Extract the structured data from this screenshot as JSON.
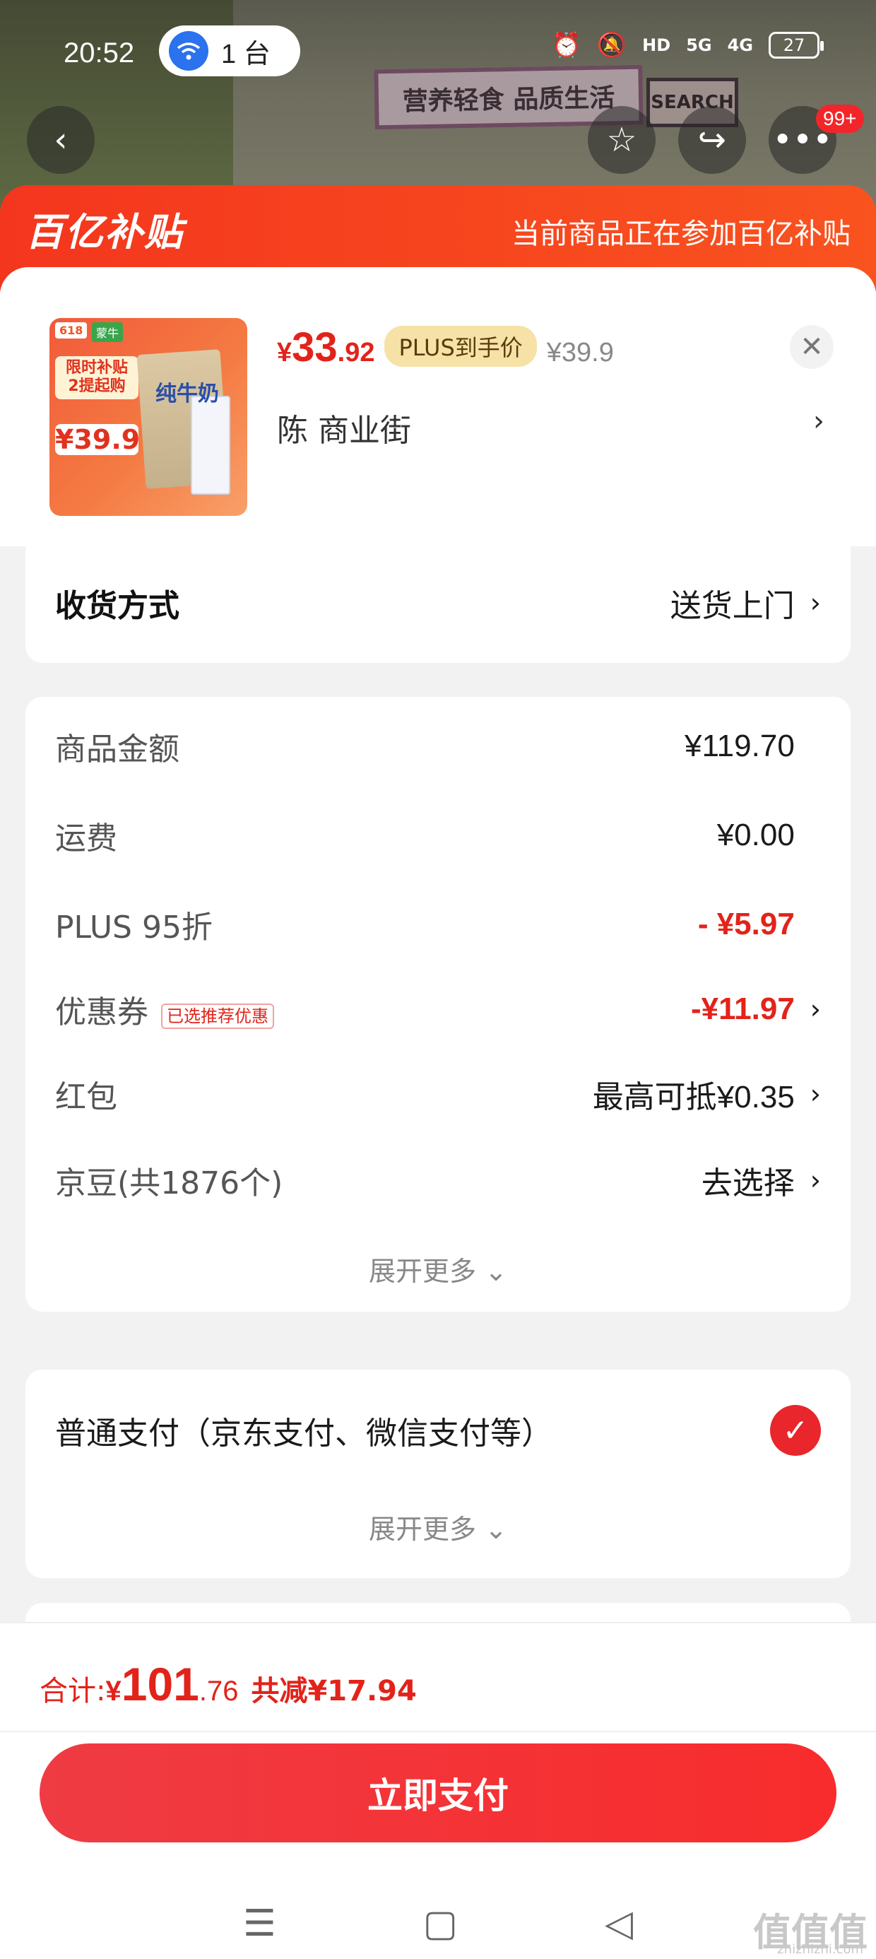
{
  "status_bar": {
    "time": "20:52",
    "hotspot_count": "1 台",
    "network_1": "5G",
    "network_2": "4G",
    "battery": "27"
  },
  "background": {
    "sign_text": "营养轻食 品质生活",
    "sign2_text": "SEARCH"
  },
  "nav": {
    "back_icon": "chevron-left-icon",
    "favorite_icon": "star-icon",
    "share_icon": "share-icon",
    "more_icon": "more-icon",
    "more_badge": "99+"
  },
  "banner": {
    "logo": "百亿补贴",
    "text": "当前商品正在参加百亿补贴"
  },
  "product": {
    "image_tag": "618",
    "image_brand": "蒙牛",
    "image_promo": "限时补贴 2提起购",
    "image_price": "¥39.9",
    "image_label": "纯牛奶",
    "price_yen": "¥",
    "price_int": "33",
    "price_dec": ".92",
    "plus_label": "PLUS到手价",
    "original_price": "¥39.9",
    "store": "陈  商业街"
  },
  "delivery": {
    "label": "收货方式",
    "value": "送货上门"
  },
  "costs": {
    "items": [
      {
        "label": "商品金额",
        "value": "¥119.70"
      },
      {
        "label": "运费",
        "value": "¥0.00"
      },
      {
        "label": "PLUS 95折",
        "value": "- ¥5.97"
      },
      {
        "label": "优惠券",
        "badge": "已选推荐优惠",
        "value": "-¥11.97"
      },
      {
        "label": "红包",
        "value_prefix": "最高可抵",
        "value": "¥0.35"
      },
      {
        "label": "京豆(共1876个)",
        "value": "去选择"
      }
    ],
    "expand": "展开更多"
  },
  "payment": {
    "label": "普通支付（京东支付、微信支付等）",
    "expand": "展开更多"
  },
  "footer": {
    "total_label": "合计: ",
    "total_yen": "¥",
    "total_int": "101",
    "total_dec": ".76",
    "reduce": "共减¥17.94",
    "pay_button": "立即支付"
  },
  "watermark": {
    "text": "值值值",
    "sub": "zhizhizhi.com"
  },
  "colors": {
    "accent_red": "#e2231a",
    "banner_orange": "#f4361e",
    "plus_gold": "#f6e2a7"
  }
}
